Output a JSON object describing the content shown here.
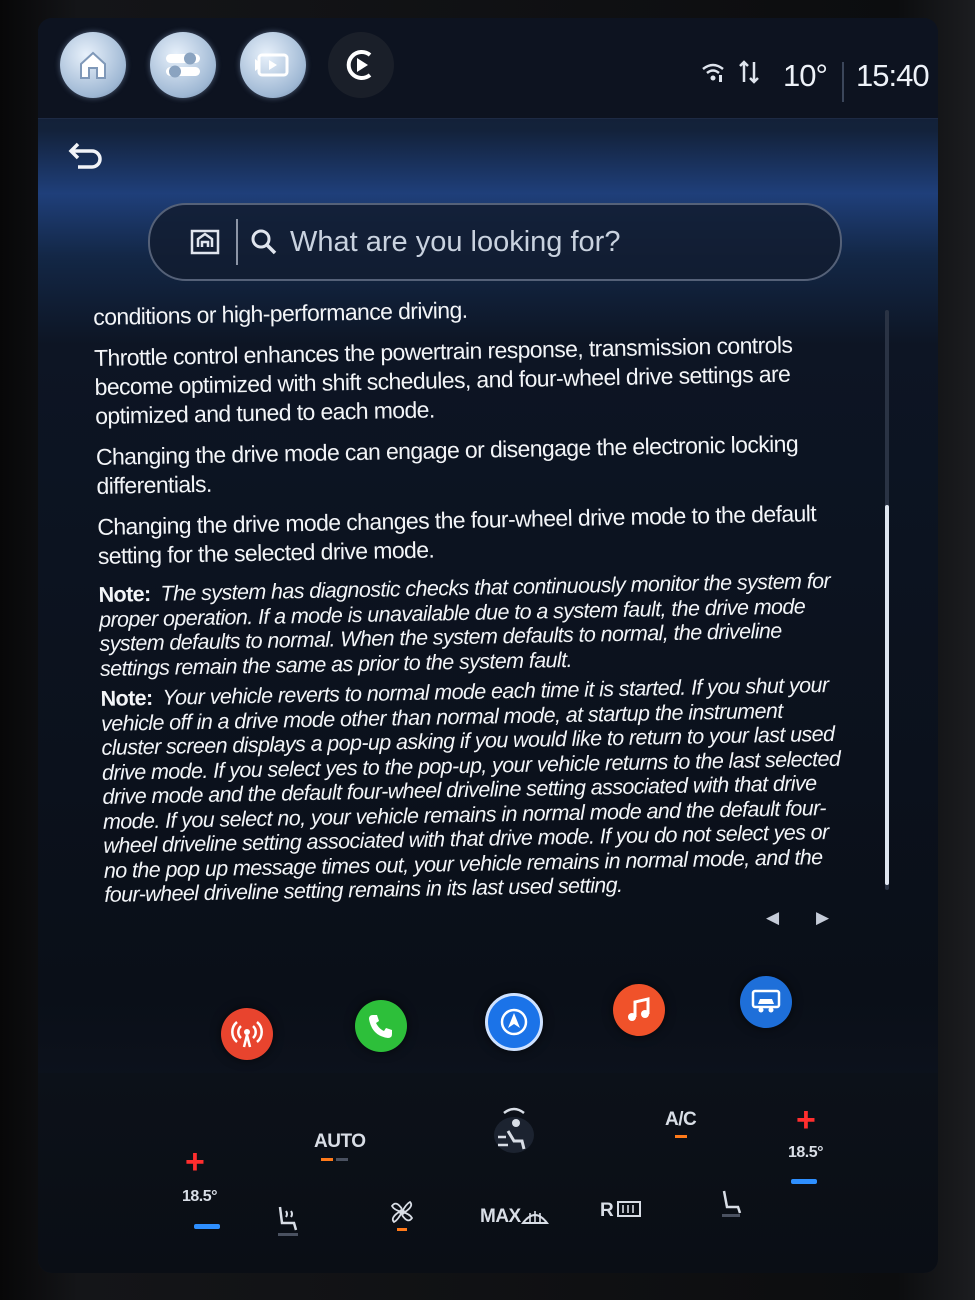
{
  "topbar": {
    "home_icon": "home-icon",
    "settings_icon": "settings-sliders-icon",
    "media_icon": "media-icon",
    "connect_icon": "phone-connect-icon",
    "temperature": "10°",
    "time": "15:40"
  },
  "search": {
    "placeholder": "What are you looking for?"
  },
  "content": {
    "p1": "conditions or high-performance driving.",
    "p2": "Throttle control enhances the powertrain response, transmission controls become optimized with shift schedules, and four-wheel drive settings are optimized and tuned to each mode.",
    "p3": "Changing the drive mode can engage or disengage the electronic locking differentials.",
    "p4": "Changing the drive mode changes the four-wheel drive mode to the default setting for the selected drive mode.",
    "note_label": "Note:",
    "note1": "The system has diagnostic checks that continuously monitor the system for proper operation. If a mode is unavailable due to a system fault, the drive mode system defaults to normal. When the system defaults to normal, the driveline settings remain the same as prior to the system fault.",
    "note2": "Your vehicle reverts to normal mode each time it is started. If you shut your vehicle off in a drive mode other than normal mode, at startup the instrument cluster screen displays a pop-up asking if you would like to return to your last used drive mode. If you select yes to the pop-up, your vehicle returns to the last selected drive mode and the default four-wheel driveline setting associated with that drive mode. If you select no, your vehicle remains in normal mode and the default four-wheel driveline setting associated with that drive mode. If you do not select yes or no the pop up message times out, your vehicle remains in normal mode, and the four-wheel driveline setting remains in its last used setting.",
    "prev": "◀",
    "next": "▶"
  },
  "dock": [
    {
      "name": "radio",
      "color": "#e8442e"
    },
    {
      "name": "phone",
      "color": "#2dbf3a"
    },
    {
      "name": "navigation",
      "color": "#1b73e8"
    },
    {
      "name": "music",
      "color": "#f0522a"
    },
    {
      "name": "vehicle",
      "color": "#1e6fd9"
    }
  ],
  "climate": {
    "left_temp": "18.5°",
    "right_temp": "18.5°",
    "auto": "AUTO",
    "ac": "A/C",
    "max": "MAX",
    "rear": "R"
  }
}
